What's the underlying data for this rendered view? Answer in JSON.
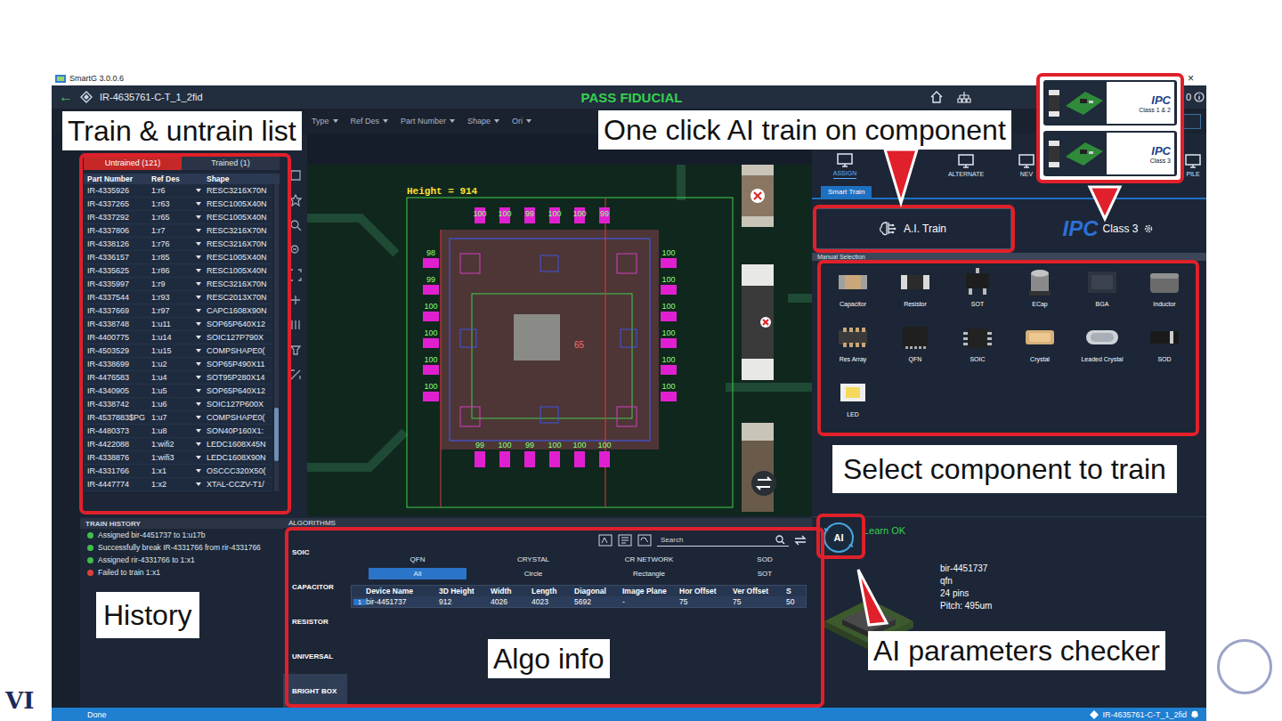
{
  "slide": {
    "logo": "VI"
  },
  "window": {
    "title": "SmartG 3.0.0.6",
    "close": "×"
  },
  "header": {
    "back": "←",
    "file": "IR-4635761-C-T_1_2fid",
    "status": "PASS FIDUCIAL",
    "counter": "0"
  },
  "filters": [
    "Type",
    "Ref Des",
    "Part Number",
    "Shape",
    "Ori"
  ],
  "train_list": {
    "tabs": [
      {
        "label": "Untrained (121)",
        "selected": true
      },
      {
        "label": "Trained (1)",
        "selected": false
      }
    ],
    "columns": [
      "Part Number",
      "Ref Des",
      "Shape"
    ],
    "scrollbar": {
      "level": 0.88
    },
    "rows": [
      {
        "part": "IR-4335926",
        "ref": "1:r6",
        "shape": "RESC3216X70N"
      },
      {
        "part": "IR-4337265",
        "ref": "1:r63",
        "shape": "RESC1005X40N"
      },
      {
        "part": "IR-4337292",
        "ref": "1:r65",
        "shape": "RESC1005X40N"
      },
      {
        "part": "IR-4337806",
        "ref": "1:r7",
        "shape": "RESC3216X70N"
      },
      {
        "part": "IR-4338126",
        "ref": "1:r76",
        "shape": "RESC3216X70N"
      },
      {
        "part": "IR-4336157",
        "ref": "1:r85",
        "shape": "RESC1005X40N"
      },
      {
        "part": "IR-4335625",
        "ref": "1:r86",
        "shape": "RESC1005X40N"
      },
      {
        "part": "IR-4335997",
        "ref": "1:r9",
        "shape": "RESC3216X70N"
      },
      {
        "part": "IR-4337544",
        "ref": "1:r93",
        "shape": "RESC2013X70N"
      },
      {
        "part": "IR-4337669",
        "ref": "1:r97",
        "shape": "CAPC1608X90N"
      },
      {
        "part": "IR-4338748",
        "ref": "1:u11",
        "shape": "SOP65P640X12"
      },
      {
        "part": "IR-4400775",
        "ref": "1:u14",
        "shape": "SOIC127P790X"
      },
      {
        "part": "IR-4503529",
        "ref": "1:u15",
        "shape": "COMPSHAPE0("
      },
      {
        "part": "IR-4338699",
        "ref": "1:u2",
        "shape": "SOP65P490X11"
      },
      {
        "part": "IR-4476583",
        "ref": "1:u4",
        "shape": "SOT95P280X14"
      },
      {
        "part": "IR-4340905",
        "ref": "1:u5",
        "shape": "SOP65P640X12"
      },
      {
        "part": "IR-4338742",
        "ref": "1:u6",
        "shape": "SOIC127P600X"
      },
      {
        "part": "IR-4537883$PG",
        "ref": "1:u7",
        "shape": "COMPSHAPE0("
      },
      {
        "part": "IR-4480373",
        "ref": "1:u8",
        "shape": "SON40P160X1:"
      },
      {
        "part": "IR-4422088",
        "ref": "1:wifi2",
        "shape": "LEDC1608X45N"
      },
      {
        "part": "IR-4338876",
        "ref": "1:wifi3",
        "shape": "LEDC1608X90N"
      },
      {
        "part": "IR-4331766",
        "ref": "1:x1",
        "shape": "OSCCC320X50("
      },
      {
        "part": "IR-4447774",
        "ref": "1:x2",
        "shape": "XTAL-CCZV-T1/"
      }
    ]
  },
  "history": {
    "title": "TRAIN HISTORY",
    "entries": [
      {
        "text": "Assigned bir-4451737 to 1:u17b",
        "color": "#3fbf4a"
      },
      {
        "text": "Successfully break IR-4331766 from rir-4331766",
        "color": "#3fbf4a"
      },
      {
        "text": "Assigned rir-4331766 to 1:x1",
        "color": "#3fbf4a"
      },
      {
        "text": "Failed to train 1:x1",
        "color": "#e0403a"
      }
    ]
  },
  "canvas": {
    "height_label": "Height = 914",
    "center": "65",
    "pads": {
      "top": [
        "100",
        "100",
        "99",
        "100",
        "100",
        "99"
      ],
      "bottom": [
        "99",
        "100",
        "99",
        "100",
        "100",
        "100"
      ],
      "left": [
        "98",
        "99",
        "100",
        "100",
        "100",
        "100"
      ],
      "right": [
        "100",
        "100",
        "100",
        "100",
        "100",
        "100"
      ]
    }
  },
  "algorithms": {
    "title": "ALGORITHMS",
    "families": [
      {
        "label": "SOIC",
        "selected": false
      },
      {
        "label": "CAPACITOR",
        "selected": false
      },
      {
        "label": "RESISTOR",
        "selected": false
      },
      {
        "label": "UNIVERSAL",
        "selected": false
      },
      {
        "label": "BRIGHT BOX",
        "selected": true
      }
    ],
    "search": {
      "placeholder": "Search"
    },
    "filters": [
      {
        "label": "QFN",
        "selected": false
      },
      {
        "label": "CRYSTAL",
        "selected": false
      },
      {
        "label": "CR NETWORK",
        "selected": false
      },
      {
        "label": "SOD",
        "selected": false
      },
      {
        "label": "All",
        "selected": true
      },
      {
        "label": "Circle",
        "selected": false
      },
      {
        "label": "Rectangle",
        "selected": false
      },
      {
        "label": "SOT",
        "selected": false
      }
    ],
    "table": {
      "columns": [
        "",
        "Device Name",
        "3D Height",
        "Width",
        "Length",
        "Diagonal",
        "Image Plane",
        "Hor Offset",
        "Ver Offset",
        "S"
      ],
      "rows": [
        [
          "1",
          "bir-4451737",
          "912",
          "4026",
          "4023",
          "5692",
          "-",
          "75",
          "75",
          "50"
        ]
      ]
    }
  },
  "right_panel": {
    "toolbar": [
      {
        "label": "ASSIGN",
        "selected": true
      },
      {
        "label": "",
        "selected": false
      },
      {
        "label": "ALTERNATE",
        "selected": false
      },
      {
        "label": "NEV",
        "selected": false
      },
      {
        "label": "PILE",
        "selected": false
      }
    ],
    "tab": "Smart Train",
    "ai_button": "A.I. Train",
    "ipc_button": {
      "brand": "IPC",
      "label": "Class 3"
    },
    "manual": {
      "title": "Manual Selection",
      "items": [
        {
          "label": "Capacitor",
          "kind": "capacitor"
        },
        {
          "label": "Resistor",
          "kind": "resistor"
        },
        {
          "label": "SOT",
          "kind": "sot"
        },
        {
          "label": "ECap",
          "kind": "ecap"
        },
        {
          "label": "BGA",
          "kind": "bga"
        },
        {
          "label": "Inductor",
          "kind": "inductor"
        },
        {
          "label": "Res Array",
          "kind": "resarray"
        },
        {
          "label": "QFN",
          "kind": "qfn"
        },
        {
          "label": "SOIC",
          "kind": "soic"
        },
        {
          "label": "Crystal",
          "kind": "crystal"
        },
        {
          "label": "Leaded Crystal",
          "kind": "leadedcrystal"
        },
        {
          "label": "SOD",
          "kind": "sod"
        },
        {
          "label": "LED",
          "kind": "led"
        }
      ]
    },
    "learn": {
      "badge": "AI",
      "status": "Learn OK",
      "details": [
        "bir-4451737",
        "qfn",
        "24 pins",
        "Pitch: 495um"
      ]
    }
  },
  "ipc_overlay": [
    {
      "brand": "IPC",
      "label": "Class 1 & 2"
    },
    {
      "brand": "IPC",
      "label": "Class 3"
    }
  ],
  "annotations": [
    "Train & untrain list",
    "One click AI train on component",
    "Select component to train",
    "History",
    "Algo info",
    "AI parameters checker"
  ],
  "status_bar": {
    "left": "Done",
    "right": "IR-4635761-C-T_1_2fid"
  }
}
